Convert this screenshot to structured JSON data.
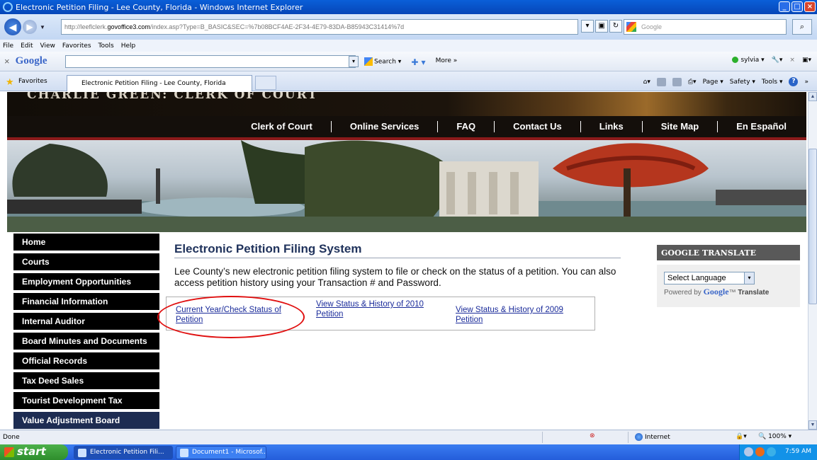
{
  "browser": {
    "window_title": "Electronic Petition Filing - Lee County, Florida - Windows Internet Explorer",
    "url_host": "http://leeflclerk.",
    "url_domain": "govoffice3.com",
    "url_path": "/index.asp?Type=B_BASIC&SEC=%7b08BCF4AE-2F34-4E79-83DA-B85943C31414%7d",
    "search_placeholder": "Google",
    "menu": [
      "File",
      "Edit",
      "View",
      "Favorites",
      "Tools",
      "Help"
    ],
    "google_toolbar": {
      "logo": "Google",
      "search_label": "Search ▾",
      "more_label": "More »",
      "user": "sylvia ▾"
    },
    "favorites_label": "Favorites",
    "tab_title": "Electronic Petition Filing - Lee County, Florida",
    "command_bar": {
      "page": "Page ▾",
      "safety": "Safety ▾",
      "tools": "Tools ▾"
    },
    "status": {
      "text": "Done",
      "zone": "Internet",
      "zoom": "100%"
    }
  },
  "site": {
    "clerk_name": "CHARLIE GREEN: CLERK OF COURT",
    "top_nav": [
      "Clerk of Court",
      "Online Services",
      "FAQ",
      "Contact Us",
      "Links",
      "Site Map",
      "En Español"
    ],
    "left_nav": [
      "Home",
      "Courts",
      "Employment Opportunities",
      "Financial Information",
      "Internal Auditor",
      "Board Minutes and Documents",
      "Official Records",
      "Tax Deed Sales",
      "Tourist Development Tax",
      "Value Adjustment Board"
    ],
    "page_title": "Electronic Petition Filing System",
    "intro_line1": "Lee County’s new electronic petition filing system to file or check on the status of a petition.  You can also",
    "intro_line2": "access petition history using your Transaction # and Password.",
    "links": [
      {
        "line1": "Current Year/Check Status of",
        "line2": "Petition"
      },
      {
        "line1": "View Status & History of 2010",
        "line2": "Petition"
      },
      {
        "line1": "View Status & History of 2009",
        "line2": "Petition"
      }
    ],
    "translate": {
      "heading": "GOOGLE TRANSLATE",
      "select_value": "Select Language",
      "powered_by": "Powered by",
      "google_word": "Google",
      "translate_word": "Translate"
    }
  },
  "taskbar": {
    "start": "start",
    "buttons": [
      "Electronic Petition Fili...",
      "Document1 - Microsof..."
    ],
    "clock": "7:59 AM"
  },
  "colors": {
    "accent_title": "#20335c",
    "link": "#1a2b9a",
    "highlight_circle": "#e01010",
    "nav_bg": "#000000",
    "nav_last_bg": "#1d2c52"
  }
}
